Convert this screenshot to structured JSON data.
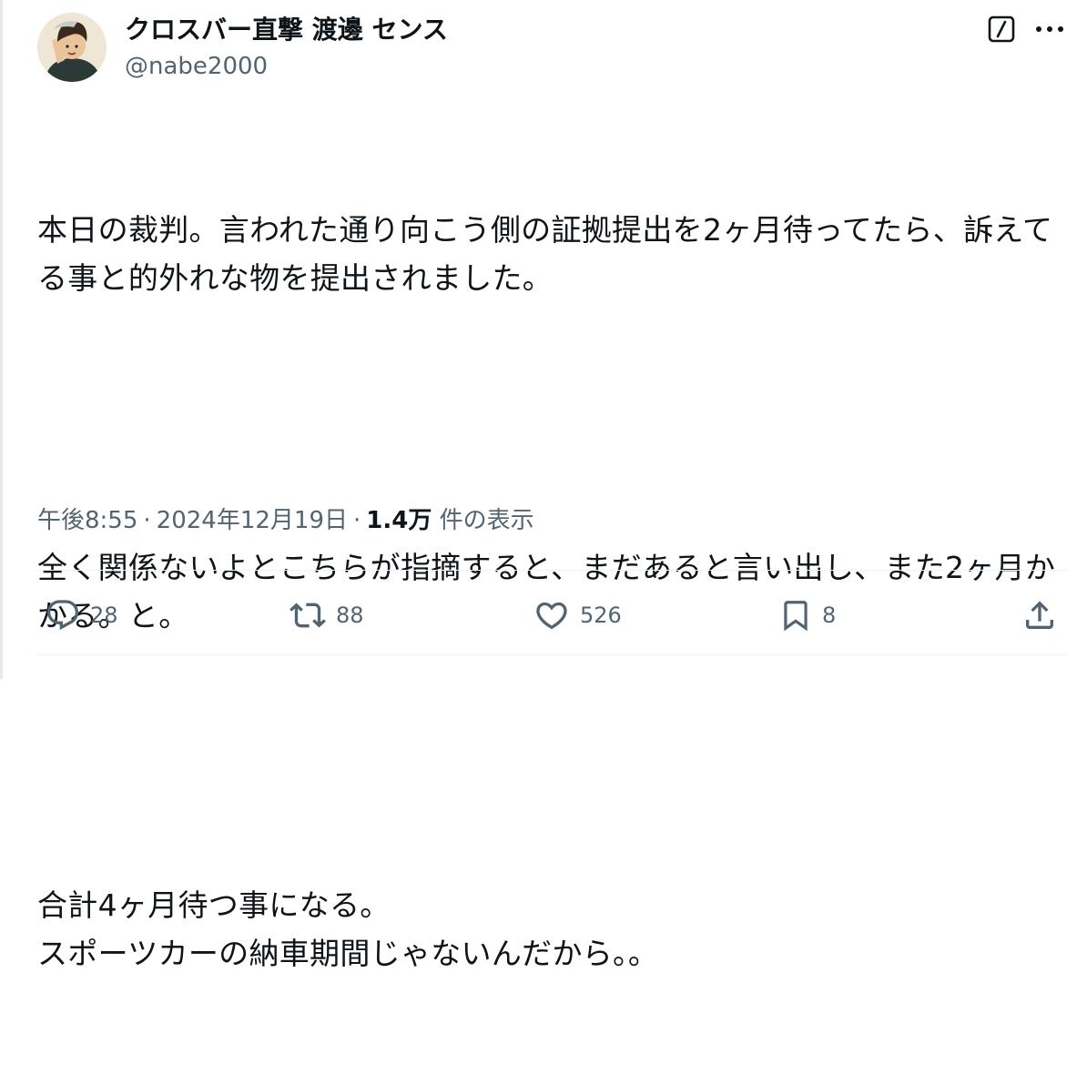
{
  "author": {
    "display_name": "クロスバー直撃 渡邊 センス",
    "handle": "@nabe2000",
    "avatar_icon": "avatar-photo"
  },
  "header_icons": {
    "grok": "grok-icon",
    "more": "more-icon"
  },
  "tweet": {
    "paragraphs": [
      "本日の裁判。言われた通り向こう側の証拠提出を2ヶ月待ってたら、訴えてる事と的外れな物を提出されました。",
      "全く関係ないよとこちらが指摘すると、まだあると言い出し、また2ヶ月かかる。と。",
      "合計4ヶ月待つ事になる。\nスポーツカーの納車期間じゃないんだから。。"
    ]
  },
  "meta": {
    "time": "午後8:55",
    "separator": "·",
    "date": "2024年12月19日",
    "views_count": "1.4万",
    "views_label": "件の表示"
  },
  "actions": {
    "reply": {
      "icon": "reply-icon",
      "count": "28"
    },
    "retweet": {
      "icon": "retweet-icon",
      "count": "88"
    },
    "like": {
      "icon": "heart-icon",
      "count": "526"
    },
    "bookmark": {
      "icon": "bookmark-icon",
      "count": "8"
    },
    "share": {
      "icon": "share-icon"
    }
  },
  "colors": {
    "text_primary": "#0f1419",
    "text_secondary": "#536471",
    "divider": "#eff3f4"
  }
}
